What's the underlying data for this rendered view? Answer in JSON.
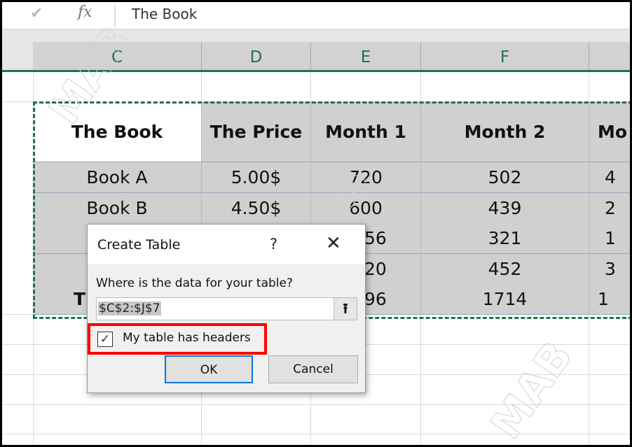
{
  "formula_bar": {
    "check_icon": "check-icon",
    "fx_label": "fx",
    "value": "The Book"
  },
  "columns": [
    "C",
    "D",
    "E",
    "F"
  ],
  "table": {
    "headers": [
      "The Book",
      "The Price",
      "Month 1",
      "Month 2",
      "Mo"
    ],
    "rows": [
      [
        "Book A",
        "5.00$",
        "720",
        "502",
        "4"
      ],
      [
        "Book B",
        "4.50$",
        "600",
        "439",
        "2"
      ],
      [
        "",
        "",
        "56",
        "321",
        "1"
      ],
      [
        "",
        "",
        "20",
        "452",
        "3"
      ],
      [
        "Th",
        "",
        "96",
        "1714",
        "1"
      ]
    ]
  },
  "dialog": {
    "title": "Create Table",
    "help": "?",
    "close": "✕",
    "question": "Where is the data for your table?",
    "range_value": "$C$2:$J$7",
    "collapse_icon": "⭱",
    "checkbox_label": "My table has headers",
    "checkbox_checked": true,
    "ok": "OK",
    "cancel": "Cancel"
  },
  "watermark": "MAB",
  "colors": {
    "accent": "#217346",
    "highlight": "#ff0000",
    "focus": "#0078d7"
  }
}
